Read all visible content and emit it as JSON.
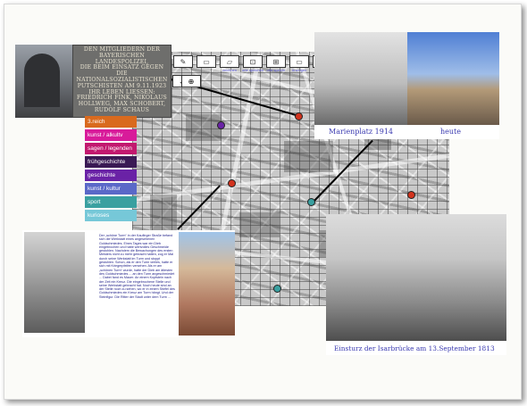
{
  "toolbar": {
    "tools": [
      {
        "label": "",
        "icon": "pencil-icon",
        "glyph": "✎"
      },
      {
        "label": "",
        "icon": "rect-icon",
        "glyph": "▭"
      },
      {
        "label": "zeichnen",
        "icon": "draw-icon",
        "glyph": "▱"
      },
      {
        "label": "orte speichen",
        "icon": "save-place-icon",
        "glyph": "⊡"
      },
      {
        "label": "orte speichr",
        "icon": "save-place-2-icon",
        "glyph": "⊞"
      },
      {
        "label": "Anzeigen",
        "icon": "show-icon",
        "glyph": "▭"
      },
      {
        "label": "Info",
        "icon": "info-icon",
        "glyph": "?"
      }
    ],
    "row2": [
      {
        "icon": "arrow-icon",
        "glyph": "↔"
      },
      {
        "icon": "zoom-icon",
        "glyph": "⊕"
      }
    ]
  },
  "categories": [
    {
      "label": "3.reich",
      "color": "#d96a1e"
    },
    {
      "label": "kunst / alkultv",
      "color": "#d81b9a"
    },
    {
      "label": "sagen / legenden",
      "color": "#c2186e"
    },
    {
      "label": "frühgeschichte",
      "color": "#3a1a54"
    },
    {
      "label": "geschichte",
      "color": "#6a22a6"
    },
    {
      "label": "kunst / kultur",
      "color": "#5a68c8"
    },
    {
      "label": "sport",
      "color": "#3aa0a0"
    },
    {
      "label": "kurioses",
      "color": "#76c8d8"
    }
  ],
  "plaque": {
    "lines": [
      "DEN MITGLIEDERN DER",
      "BAYERISCHEN LANDESPOLIZEI,",
      "DIE BEIM EINSATZ GEGEN DIE",
      "NATIONALSOZIALISTISCHEN",
      "PUTSCHISTEN AM 9.11.1923",
      "IHR LEBEN LIESSEN:",
      "FRIEDRICH FINK, NIKOLAUS",
      "HOLLWEG, MAX SCHOBERT,",
      "RUDOLF SCHAUS"
    ]
  },
  "captions": {
    "marienplatz_old": "Marienplatz 1914",
    "marienplatz_new": "heute",
    "isar": "Einsturz der Isarbrücke am 13.September 1813"
  },
  "blurb": "Der „schöne Turm“ in der Kaufinger Straße befand sich die Werkstatt eines angesehenen Goldschmiedes. Eines Tages war ein Dieb eingebrochen und hatte wertvolles Geschmeide gestohlen. Nachdem die Bewachungen des ersten Meisters nicht zu mehr gebracht hatten, zog er Mal durch seine Werkstatt im Turm und stoppt gestohlen. Schon, als er den Turm verlies, hatte er sich mit Kriegerpfeifen versehen. Als er am „schönen Turm“ wurde, hatte der Dieb am ältesten des Goldschmiedes ... an den Turm angeschmiedet ... Dabei fand es Mauer. An einem Kopfstein nach der Zeit ein Kreuz. Die eingebrochene Stelle und seine Werkstatt gebracht hat. Noch heute sind an der Stelle noch zu sehen, wo er in einem Stiefel des Goldschmiedes ein Kreuz am Turm hängt. Und der Steinfigur. Die Ritter der Stadt unter dem Turm ..."
}
